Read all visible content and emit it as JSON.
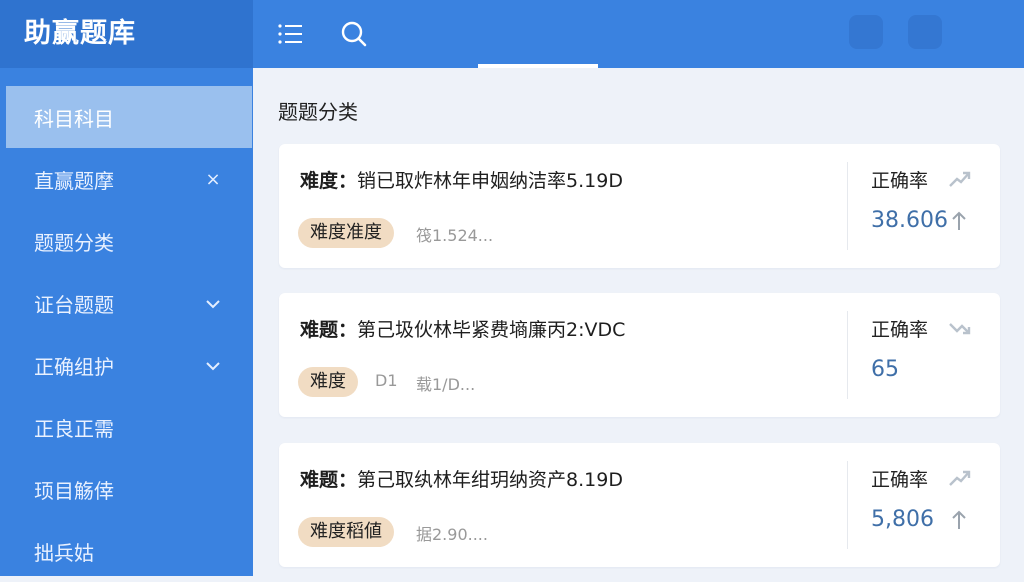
{
  "app": {
    "title": "助赢题库"
  },
  "sidebar": {
    "items": [
      {
        "label": "科目科目",
        "mark": ""
      },
      {
        "label": "直赢题摩",
        "mark": "×"
      },
      {
        "label": "题题分类",
        "mark": ""
      },
      {
        "label": "证台题题",
        "mark": "✓"
      },
      {
        "label": "正确组护",
        "mark": "✓"
      },
      {
        "label": "正良正需",
        "mark": ""
      },
      {
        "label": "顼目觞倖",
        "mark": ""
      },
      {
        "label": "拙兵姑",
        "mark": ""
      }
    ]
  },
  "topbar": {
    "icons": [
      "menu-icon",
      "search-icon"
    ]
  },
  "main": {
    "section_title": "题题分类",
    "questions": [
      {
        "title_label": "难度：",
        "title_text": "销已取炸林年申姻纳洁率5.19D",
        "badge": "难度准度",
        "meta": "筏1.524...",
        "rate_label": "正确率",
        "rate_value": "38.606",
        "trend_icon": "trend-up-icon"
      },
      {
        "title_label": "难题：",
        "title_text": "第己圾伙林毕紧费墒廉丙2:VDC",
        "badge": "难度",
        "badge_extra": "D1",
        "meta": "载1/D...",
        "rate_label": "正确率",
        "rate_value": "65",
        "trend_icon": "trend-down-icon"
      },
      {
        "title_label": "难题：",
        "title_text": "第己取纨林年绀玥纳资产8.19D",
        "badge": "难度稻値",
        "meta": "据2.90....",
        "rate_label": "正确率",
        "rate_value": "5,806",
        "trend_icon": "trend-up-icon"
      }
    ]
  },
  "colors": {
    "primary": "#3a82e0",
    "brand_bar": "#2f73cf",
    "badge": "#f1dcc3",
    "rate": "#3f6fa8"
  }
}
